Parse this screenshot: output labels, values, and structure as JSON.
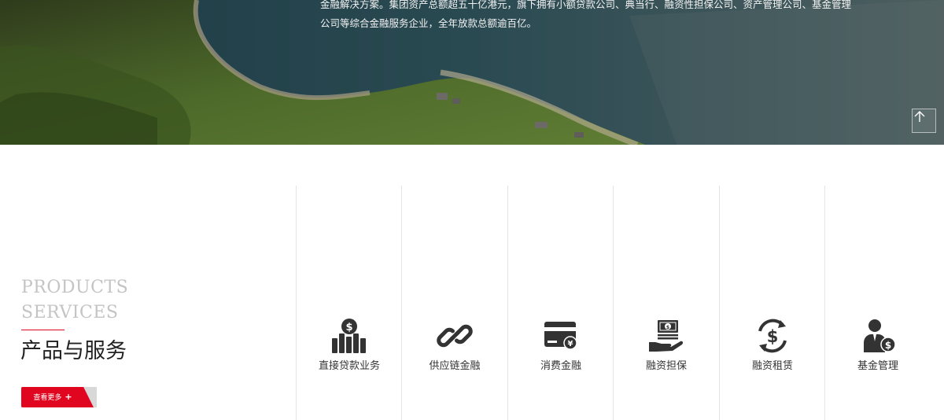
{
  "hero": {
    "text_lines": [
      "金融解决方案。集团资产总额超五十亿港元，旗下拥有小额贷款公司、典当行、融资性担保公司、资产管理公司、基金管理",
      "公司等综合金融服务企业，全年放款总额逾百亿。"
    ],
    "back_to_top_icon": "arrow-up-icon"
  },
  "intro": {
    "en_line1": "PRODUCTS",
    "en_line2": "SERVICES",
    "cn_title": "产品与服务",
    "more_label": "查看更多",
    "more_plus": "+",
    "accent_color": "#e1061f"
  },
  "products": [
    {
      "label": "直接贷款业务",
      "icon": "loan-chart-icon"
    },
    {
      "label": "供应链金融",
      "icon": "chain-link-icon"
    },
    {
      "label": "消费金融",
      "icon": "card-yuan-icon"
    },
    {
      "label": "融资担保",
      "icon": "cash-hand-icon"
    },
    {
      "label": "融资租赁",
      "icon": "dollar-cycle-icon"
    },
    {
      "label": "基金管理",
      "icon": "manager-dollar-icon"
    }
  ]
}
